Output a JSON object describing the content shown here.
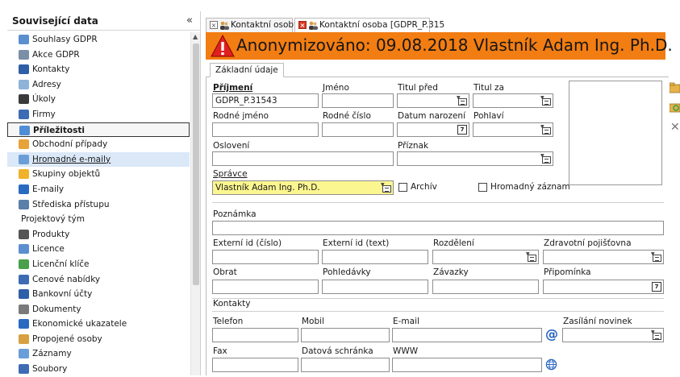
{
  "sidebar": {
    "title": "Související data",
    "collapse": "«",
    "items": [
      {
        "label": "Souhlasy GDPR",
        "icon": "consent-icon",
        "color": "#5b8fcf"
      },
      {
        "label": "Akce GDPR",
        "icon": "gdpr-action-icon",
        "color": "#7b8fa6"
      },
      {
        "label": "Kontakty",
        "icon": "contacts-icon",
        "color": "#2f5fa8"
      },
      {
        "label": "Adresy",
        "icon": "envelope-icon",
        "color": "#8db3d9"
      },
      {
        "label": "Úkoly",
        "icon": "calendar-icon",
        "color": "#3a3a3a"
      },
      {
        "label": "Firmy",
        "icon": "building-icon",
        "color": "#3d6cb5"
      },
      {
        "label": "Příležitosti",
        "icon": "opportunity-icon",
        "color": "#4f8ed6"
      },
      {
        "label": "Obchodní případy",
        "icon": "case-icon",
        "color": "#e8a23a"
      },
      {
        "label": "Hromadné e-maily",
        "icon": "bulk-email-icon",
        "color": "#6a9ed8"
      },
      {
        "label": "Skupiny objektů",
        "icon": "star-icon",
        "color": "#f0b22a"
      },
      {
        "label": "E-maily",
        "icon": "at-icon",
        "color": "#2a6bc2"
      },
      {
        "label": "Střediska přístupu",
        "icon": "access-icon",
        "color": "#5a7fa8"
      },
      {
        "label": "Projektový tým",
        "icon": "",
        "color": ""
      },
      {
        "label": "Produkty",
        "icon": "barcode-icon",
        "color": "#555555"
      },
      {
        "label": "Licence",
        "icon": "license-icon",
        "color": "#5b8fcf"
      },
      {
        "label": "Licenční klíče",
        "icon": "license-key-icon",
        "color": "#4aa04a"
      },
      {
        "label": "Cenové nabídky",
        "icon": "quote-icon",
        "color": "#3d6cb5"
      },
      {
        "label": "Bankovní účty",
        "icon": "bank-icon",
        "color": "#2f5fa8"
      },
      {
        "label": "Dokumenty",
        "icon": "document-icon",
        "color": "#7a7a7a"
      },
      {
        "label": "Ekonomické ukazatele",
        "icon": "chart-icon",
        "color": "#2a6bc2"
      },
      {
        "label": "Propojené osoby",
        "icon": "linked-persons-icon",
        "color": "#d8a040"
      },
      {
        "label": "Záznamy",
        "icon": "records-icon",
        "color": "#6a9ed8"
      },
      {
        "label": "Soubory",
        "icon": "files-icon",
        "color": "#3d6cb5"
      }
    ]
  },
  "tabs": [
    {
      "label": "Kontaktní osoby"
    },
    {
      "label": "Kontaktní osoba [GDPR_P.315"
    }
  ],
  "banner": {
    "text": "Anonymizováno: 09.08.2018 Vlastník  Adam Ing. Ph.D.",
    "color": "#f27d12"
  },
  "form": {
    "sub_tab": "Základní údaje",
    "prijmeni": {
      "label": "Příjmení",
      "value": "GDPR_P.31543"
    },
    "jmeno": {
      "label": "Jméno",
      "value": ""
    },
    "titul_pred": {
      "label": "Titul před",
      "value": ""
    },
    "titul_za": {
      "label": "Titul za",
      "value": ""
    },
    "rodne_jmeno": {
      "label": "Rodné jméno",
      "value": ""
    },
    "rodne_cislo": {
      "label": "Rodné číslo",
      "value": ""
    },
    "datum_narozeni": {
      "label": "Datum narození",
      "value": ""
    },
    "pohlavi": {
      "label": "Pohlaví",
      "value": ""
    },
    "osloveni": {
      "label": "Oslovení",
      "value": ""
    },
    "priznak": {
      "label": "Příznak",
      "value": ""
    },
    "spravce": {
      "label": "Správce",
      "value": "Vlastník  Adam Ing. Ph.D."
    },
    "archiv": {
      "label": "Archív",
      "checked": false
    },
    "hromadny": {
      "label": "Hromadný záznam",
      "checked": false
    },
    "poznamka": {
      "label": "Poznámka",
      "value": ""
    },
    "externi_id_cislo": {
      "label": "Externí id (číslo)",
      "value": ""
    },
    "externi_id_text": {
      "label": "Externí id (text)",
      "value": ""
    },
    "rozdeleni": {
      "label": "Rozdělení",
      "value": ""
    },
    "pojistovna": {
      "label": "Zdravotní pojišťovna",
      "value": ""
    },
    "obrat": {
      "label": "Obrat",
      "value": ""
    },
    "pohledavky": {
      "label": "Pohledávky",
      "value": ""
    },
    "zavazky": {
      "label": "Závazky",
      "value": ""
    },
    "pripominka": {
      "label": "Připomínka",
      "value": ""
    },
    "kontakty_heading": "Kontakty",
    "telefon": {
      "label": "Telefon",
      "value": ""
    },
    "mobil": {
      "label": "Mobil",
      "value": ""
    },
    "email": {
      "label": "E-mail",
      "value": ""
    },
    "zasilani": {
      "label": "Zasílání novinek",
      "value": ""
    },
    "fax": {
      "label": "Fax",
      "value": ""
    },
    "datova": {
      "label": "Datová schránka",
      "value": ""
    },
    "www": {
      "label": "WWW",
      "value": ""
    }
  }
}
